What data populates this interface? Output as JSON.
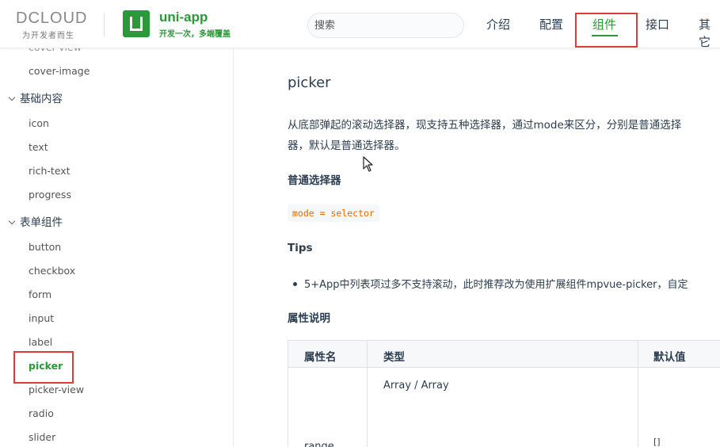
{
  "header": {
    "dcloud_word": "DCLOUD",
    "dcloud_tagline": "为开发者而生",
    "uni_title": "uni-app",
    "uni_subtitle": "开发一次，多端覆盖",
    "search_placeholder": "搜索",
    "nav": [
      {
        "label": "介绍"
      },
      {
        "label": "配置"
      },
      {
        "label": "组件",
        "active": true
      },
      {
        "label": "接口"
      },
      {
        "label": "其它"
      }
    ],
    "brand_color": "#2b9939",
    "highlight_color": "#e03b3b"
  },
  "sidebar": {
    "items": [
      {
        "label": "cover-view"
      },
      {
        "label": "cover-image"
      },
      {
        "label": "基础内容",
        "group": true
      },
      {
        "label": "icon"
      },
      {
        "label": "text"
      },
      {
        "label": "rich-text"
      },
      {
        "label": "progress"
      },
      {
        "label": "表单组件",
        "group": true
      },
      {
        "label": "button"
      },
      {
        "label": "checkbox"
      },
      {
        "label": "form"
      },
      {
        "label": "input"
      },
      {
        "label": "label"
      },
      {
        "label": "picker",
        "active": true
      },
      {
        "label": "picker-view"
      },
      {
        "label": "radio"
      },
      {
        "label": "slider"
      }
    ]
  },
  "main": {
    "title": "picker",
    "description_line1": "从底部弹起的滚动选择器，现支持五种选择器，通过mode来区分，分别是普通选择",
    "description_line2": "器，默认是普通选择器。",
    "section_normal": "普通选择器",
    "code": "mode = selector",
    "tips_title": "Tips",
    "tip_1": "5+App中列表项过多不支持滚动，此时推荐改为使用扩展组件mpvue-picker，自定",
    "props_title": "属性说明",
    "table": {
      "headers": [
        "属性名",
        "类型",
        "默认值"
      ],
      "rows": [
        {
          "name": "range",
          "type": "Array / Array",
          "default": "[]"
        }
      ]
    }
  }
}
